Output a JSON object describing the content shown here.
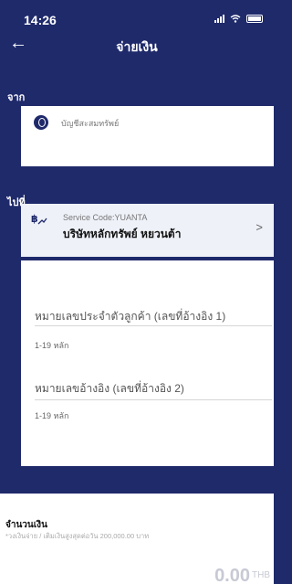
{
  "status_bar": {
    "time": "14:26"
  },
  "header": {
    "title": "จ่ายเงิน"
  },
  "from_section": {
    "label": "จาก",
    "account_name": "บัญชีสะสมทรัพย์"
  },
  "to_section": {
    "label": "ไปที่",
    "service_code": "Service Code:YUANTA",
    "company_name": "บริษัทหลักทรัพย์ หยวนต้า"
  },
  "reference": {
    "ref1_label": "หมายเลขประจำตัวลูกค้า (เลขที่อ้างอิง 1)",
    "ref1_hint": "1-19 หลัก",
    "ref2_label": "หมายเลขอ้างอิง (เลขที่อ้างอิง 2)",
    "ref2_hint": "1-19 หลัก"
  },
  "amount": {
    "title": "จำนวนเงิน",
    "subtitle": "*วงเงินจ่าย / เติมเงินสูงสุดต่อวัน 200,000.00 บาท",
    "value": "0.00",
    "currency": "THB"
  },
  "icons": {
    "back": "back-arrow-icon",
    "account": "bank-logo-icon",
    "biller": "biller-icon",
    "chevron": "chevron-right-icon"
  },
  "colors": {
    "primary": "#1f2a6b",
    "card": "#eef1f8",
    "placeholder": "#c7c9d4"
  }
}
